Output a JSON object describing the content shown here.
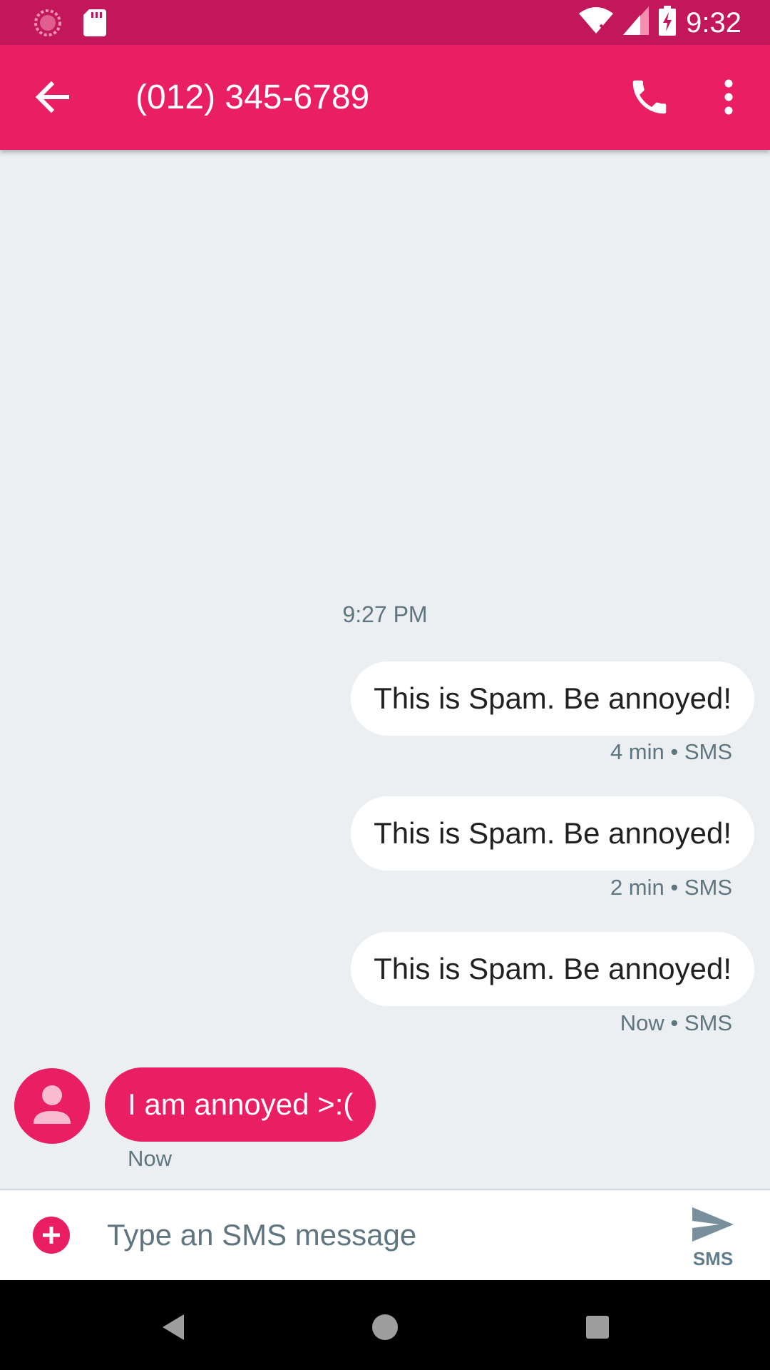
{
  "status_bar": {
    "time": "9:32",
    "icons": [
      "loading-icon",
      "sd-card-icon",
      "wifi-icon",
      "signal-icon",
      "battery-charging-icon"
    ]
  },
  "toolbar": {
    "title": "(012) 345-6789",
    "icons": [
      "back-arrow-icon",
      "phone-icon",
      "more-vert-icon"
    ]
  },
  "thread": {
    "timestamp": "9:27 PM",
    "outgoing": [
      {
        "text": "This is Spam. Be annoyed!",
        "meta": "4 min • SMS"
      },
      {
        "text": "This is Spam. Be annoyed!",
        "meta": "2 min • SMS"
      },
      {
        "text": "This is Spam. Be annoyed!",
        "meta": "Now • SMS"
      }
    ],
    "incoming": {
      "text": "I am annoyed >:(",
      "meta": "Now"
    }
  },
  "compose": {
    "placeholder": "Type an SMS message",
    "send_label": "SMS"
  },
  "colors": {
    "accent": "#E91E63",
    "status_bar": "#C2185B",
    "background": "#ECEFF1"
  }
}
